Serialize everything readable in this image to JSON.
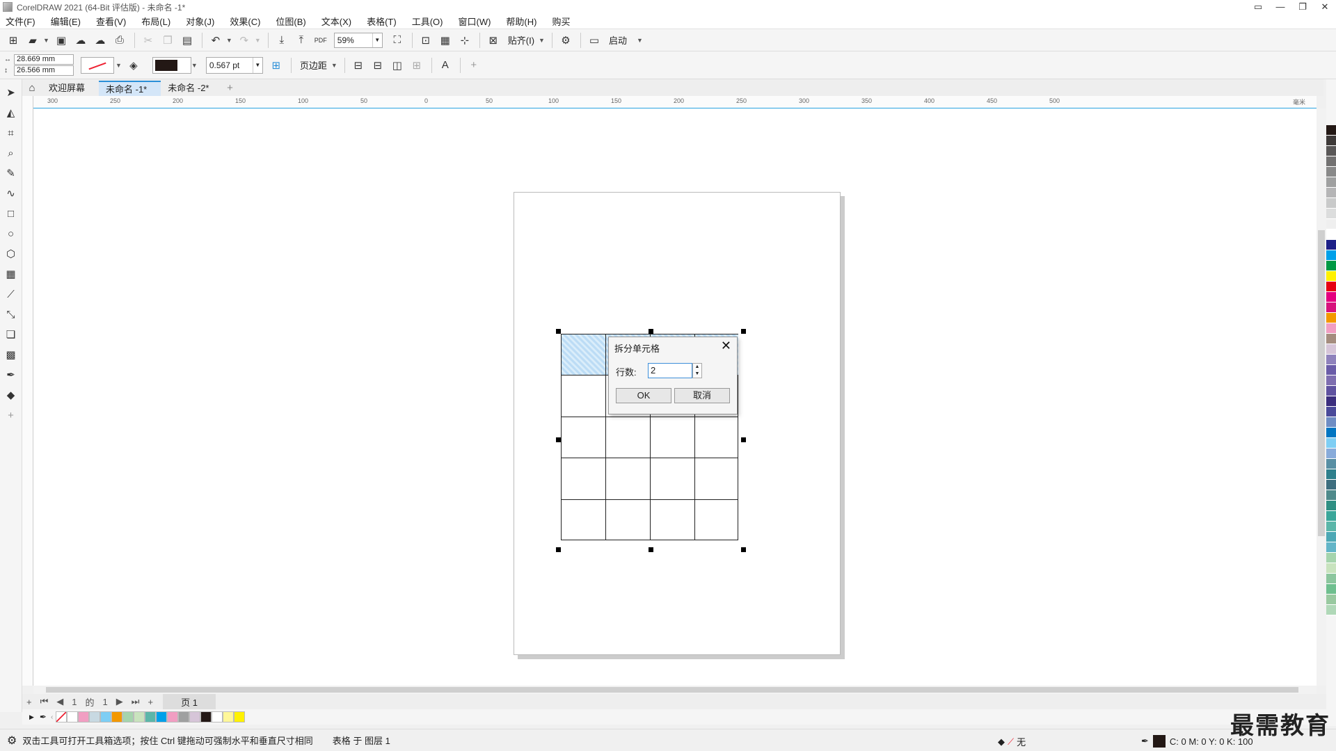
{
  "window": {
    "title": "CorelDRAW 2021 (64-Bit 评估版) - 未命名 -1*",
    "controls": [
      "▭",
      "—",
      "❐",
      "✕"
    ]
  },
  "menu": [
    "文件(F)",
    "编辑(E)",
    "查看(V)",
    "布局(L)",
    "对象(J)",
    "效果(C)",
    "位图(B)",
    "文本(X)",
    "表格(T)",
    "工具(O)",
    "窗口(W)",
    "帮助(H)",
    "购买"
  ],
  "toolbar": {
    "zoom": "59%",
    "snap_label": "贴齐(I)",
    "launch_label": "启动",
    "pdf_label": "PDF"
  },
  "property_bar": {
    "width": "28.669 mm",
    "height": "26.566 mm",
    "outline_width": "0.567 pt",
    "margin_label": "页边距"
  },
  "tabs": [
    {
      "label": "欢迎屏幕"
    },
    {
      "label": "未命名 -1*"
    },
    {
      "label": "未命名 -2*"
    }
  ],
  "ruler_h": [
    "300",
    "250",
    "200",
    "150",
    "100",
    "50",
    "0",
    "50",
    "100",
    "150",
    "200",
    "250",
    "300",
    "350",
    "400",
    "450",
    "500",
    "毫米"
  ],
  "page_nav": {
    "current": "1",
    "of": "的",
    "total": "1",
    "page_tab": "页 1"
  },
  "dialog": {
    "title": "拆分单元格",
    "row_label": "行数:",
    "row_value": "2",
    "ok": "OK",
    "cancel": "取消"
  },
  "status": {
    "hint": "双击工具可打开工具箱选项；按住 Ctrl 键拖动可强制水平和垂直尺寸相同",
    "layer": "表格 于 图层 1",
    "fill_none": "无",
    "cmyk": "C: 0 M: 0 Y: 0 K: 100"
  },
  "watermark": "最需教育",
  "colors": {
    "accent": "#2a8fd8",
    "selection": "#bcdcf5",
    "outline": "#231815"
  },
  "palette_colors": [
    "#231815",
    "#3e3a39",
    "#595757",
    "#727171",
    "#898989",
    "#9fa0a0",
    "#b5b5b6",
    "#c9caca",
    "#dcdddd",
    "#efefef",
    "#ffffff",
    "#1d2088",
    "#00a0e9",
    "#009944",
    "#fff100",
    "#e60012",
    "#e4007f",
    "#d7137d",
    "#f39800",
    "#f19ec2",
    "#a58d7f",
    "#d6c5d8",
    "#8f82bc",
    "#6a5ca8",
    "#7e6eb0",
    "#5f52a0",
    "#3b2e7e",
    "#4a4a9a",
    "#6f8dc4",
    "#0075c2",
    "#7ecef4",
    "#88abda",
    "#588fa4",
    "#2e7f8c",
    "#3e6e7f",
    "#4f8a8b",
    "#2f8f83",
    "#3aa69a",
    "#5bb6a9",
    "#4da8b5",
    "#63b5c8",
    "#a5d4ad",
    "#c8e3be",
    "#8cc69e",
    "#6fbf8f",
    "#99c9a0",
    "#b0d8b8"
  ],
  "doc_palette_colors": [
    "#ffffff",
    "#f19ec2",
    "#c8d9e2",
    "#7ecef4",
    "#f39800",
    "#a5d4ad",
    "#c9e3be",
    "#5bb6a9",
    "#00a0e9",
    "#f19ec2",
    "#9fa0a0",
    "#d6c5d8",
    "#231815",
    "#ffffff",
    "#fff799",
    "#fff100"
  ]
}
